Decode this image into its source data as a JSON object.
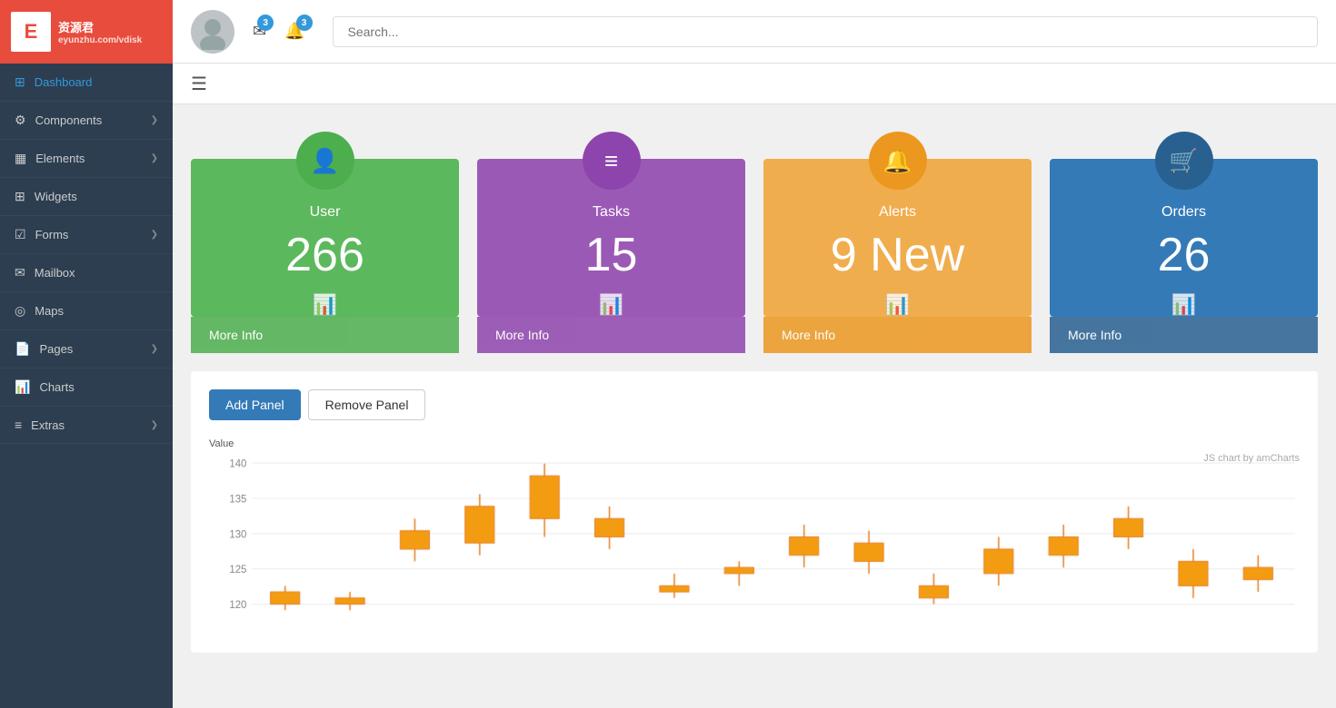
{
  "sidebar": {
    "logo": {
      "letter": "E",
      "text1": "资源君",
      "text2": "eyunzhu.com/vdisk"
    },
    "items": [
      {
        "id": "dashboard",
        "label": "Dashboard",
        "icon": "⊞",
        "active": true,
        "hasChevron": false
      },
      {
        "id": "components",
        "label": "Components",
        "icon": "⚙",
        "active": false,
        "hasChevron": true
      },
      {
        "id": "elements",
        "label": "Elements",
        "icon": "▦",
        "active": false,
        "hasChevron": true
      },
      {
        "id": "widgets",
        "label": "Widgets",
        "icon": "⊞",
        "active": false,
        "hasChevron": false
      },
      {
        "id": "forms",
        "label": "Forms",
        "icon": "☑",
        "active": false,
        "hasChevron": true
      },
      {
        "id": "mailbox",
        "label": "Mailbox",
        "icon": "✉",
        "active": false,
        "hasChevron": false
      },
      {
        "id": "maps",
        "label": "Maps",
        "icon": "◎",
        "active": false,
        "hasChevron": false
      },
      {
        "id": "pages",
        "label": "Pages",
        "icon": "📄",
        "active": false,
        "hasChevron": true
      },
      {
        "id": "charts",
        "label": "Charts",
        "icon": "📊",
        "active": false,
        "hasChevron": false
      },
      {
        "id": "extras",
        "label": "Extras",
        "icon": "≡",
        "active": false,
        "hasChevron": true
      }
    ]
  },
  "header": {
    "mail_badge": "3",
    "alert_badge": "3",
    "search_placeholder": "Search..."
  },
  "stat_cards": [
    {
      "id": "user",
      "label": "User",
      "value": "266",
      "footer": "More Info",
      "color_class": "card-green",
      "icon": "👤"
    },
    {
      "id": "tasks",
      "label": "Tasks",
      "value": "15",
      "footer": "More Info",
      "color_class": "card-purple",
      "icon": "≡"
    },
    {
      "id": "alerts",
      "label": "Alerts",
      "value": "9 New",
      "footer": "More Info",
      "color_class": "card-orange",
      "icon": "🔔"
    },
    {
      "id": "orders",
      "label": "Orders",
      "value": "26",
      "footer": "More Info",
      "color_class": "card-blue",
      "icon": "🛒"
    }
  ],
  "chart_section": {
    "add_panel_label": "Add Panel",
    "remove_panel_label": "Remove Panel",
    "value_label": "Value",
    "amcharts_label": "JS chart by amCharts",
    "y_labels": [
      "140",
      "135",
      "130",
      "125",
      "120"
    ],
    "candles": [
      {
        "open": 121,
        "close": 119,
        "high": 122,
        "low": 118,
        "color": "orange"
      },
      {
        "open": 120,
        "close": 119,
        "high": 121,
        "low": 118,
        "color": "orange"
      },
      {
        "open": 131,
        "close": 128,
        "high": 133,
        "low": 126,
        "color": "orange"
      },
      {
        "open": 135,
        "close": 129,
        "high": 137,
        "low": 127,
        "color": "orange"
      },
      {
        "open": 140,
        "close": 133,
        "high": 142,
        "low": 130,
        "color": "orange"
      },
      {
        "open": 133,
        "close": 130,
        "high": 135,
        "low": 128,
        "color": "orange"
      },
      {
        "open": 122,
        "close": 121,
        "high": 124,
        "low": 120,
        "color": "green"
      },
      {
        "open": 125,
        "close": 124,
        "high": 126,
        "low": 122,
        "color": "orange"
      },
      {
        "open": 130,
        "close": 127,
        "high": 132,
        "low": 125,
        "color": "orange"
      },
      {
        "open": 129,
        "close": 126,
        "high": 131,
        "low": 124,
        "color": "orange"
      },
      {
        "open": 122,
        "close": 120,
        "high": 124,
        "low": 119,
        "color": "green"
      },
      {
        "open": 128,
        "close": 124,
        "high": 130,
        "low": 122,
        "color": "orange"
      },
      {
        "open": 130,
        "close": 127,
        "high": 132,
        "low": 125,
        "color": "orange"
      },
      {
        "open": 133,
        "close": 130,
        "high": 135,
        "low": 128,
        "color": "orange"
      },
      {
        "open": 126,
        "close": 122,
        "high": 128,
        "low": 120,
        "color": "green"
      },
      {
        "open": 125,
        "close": 123,
        "high": 127,
        "low": 121,
        "color": "green"
      }
    ]
  }
}
